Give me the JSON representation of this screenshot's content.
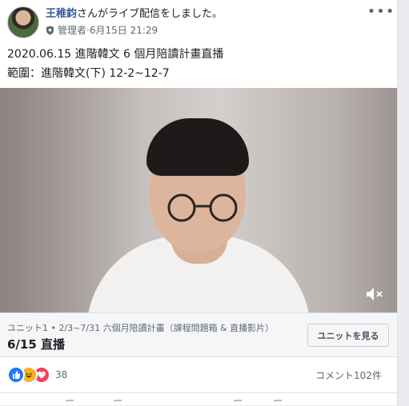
{
  "post": {
    "author": "王稚鈞",
    "action": "さんがライブ配信をしました。",
    "role": "管理者",
    "separator": " · ",
    "timestamp": "6月15日 21:29",
    "menu_icon": "more-options-icon",
    "lines": [
      "2020.06.15 進階韓文 6 個月陪讀計畫直播",
      "範圍：進階韓文(下) 12-2~12-7"
    ]
  },
  "video": {
    "audio_state": "muted",
    "icon": "speaker-muted-icon"
  },
  "unit": {
    "subtitle": "ユニット1 • 2/3~7/31 六個月陪讀計畫（課程問題箱 & 直播影片）",
    "title": "6/15 直播",
    "button_label": "ユニットを見る"
  },
  "engagement": {
    "reaction_icons": [
      "like-icon",
      "haha-icon",
      "love-icon"
    ],
    "reaction_count": "38",
    "comments": "コメント102件"
  },
  "colors": {
    "link": "#385898",
    "like": "#2078f4",
    "haha": "#f7b125",
    "love": "#f33e58"
  }
}
